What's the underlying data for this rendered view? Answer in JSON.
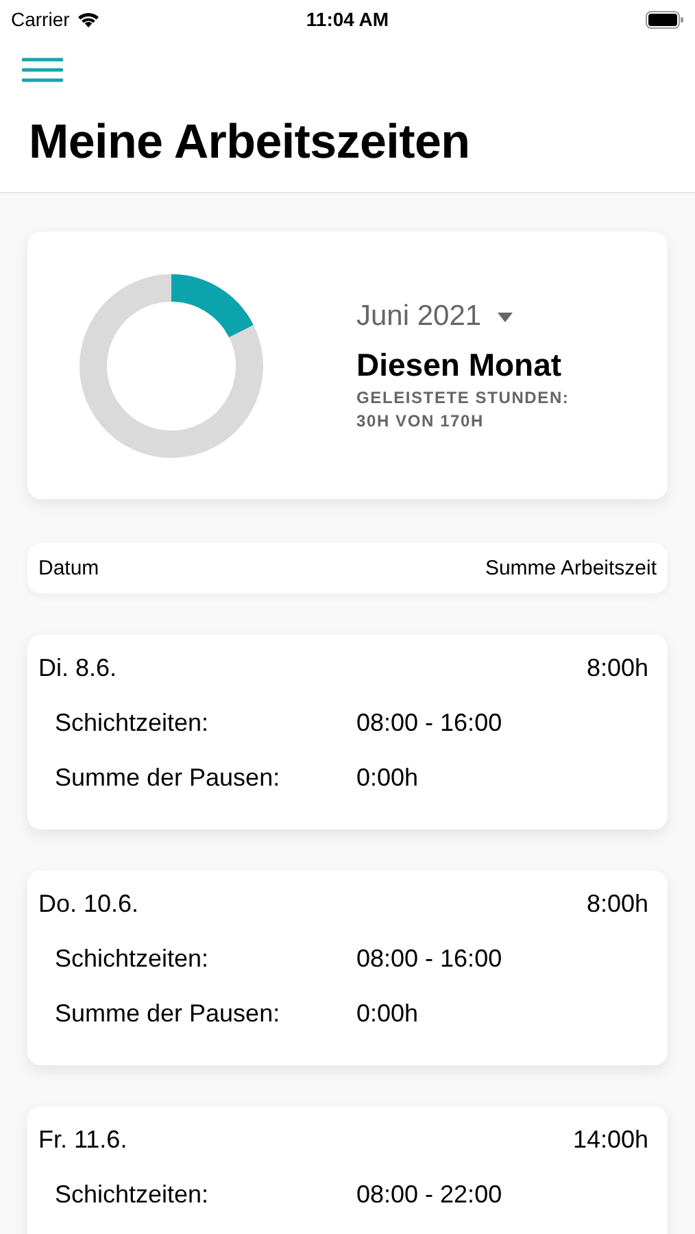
{
  "status_bar": {
    "carrier": "Carrier",
    "time": "11:04 AM"
  },
  "title": "Meine Arbeitszeiten",
  "summary": {
    "month": "Juni 2021",
    "heading": "Diesen Monat",
    "caption": "GELEISTETE STUNDEN:",
    "hours": "30H VON 170H",
    "level": 0.176
  },
  "table": {
    "columns": [
      "Datum",
      "Summe Arbeitszeit"
    ]
  },
  "days": [
    {
      "date": "Di. 8.6.",
      "total": "8:00h",
      "rows": [
        {
          "label": "Schichtzeiten:",
          "value": "08:00 - 16:00"
        },
        {
          "label": "Summe der Pausen:",
          "value": "0:00h"
        }
      ]
    },
    {
      "date": "Do. 10.6.",
      "total": "8:00h",
      "rows": [
        {
          "label": "Schichtzeiten:",
          "value": "08:00 - 16:00"
        },
        {
          "label": "Summe der Pausen:",
          "value": "0:00h"
        }
      ]
    },
    {
      "date": "Fr. 11.6.",
      "total": "14:00h",
      "rows": [
        {
          "label": "Schichtzeiten:",
          "value": "08:00 - 22:00"
        }
      ]
    }
  ]
}
